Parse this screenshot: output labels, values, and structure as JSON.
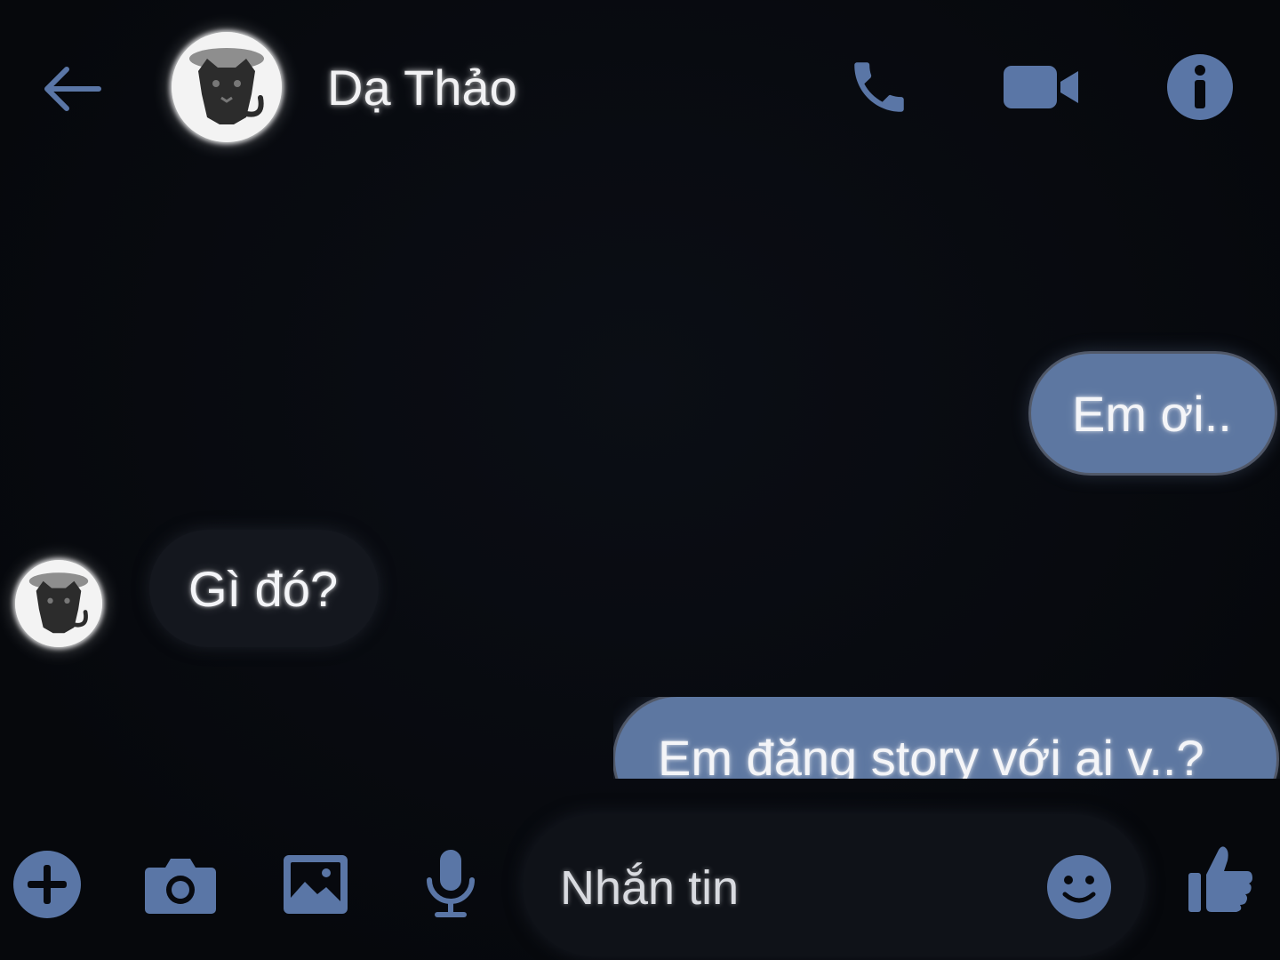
{
  "theme": {
    "accent": "#5a76a6",
    "bubble_outgoing": "#5d77a1",
    "bubble_incoming": "#14171e",
    "background": "#07090e"
  },
  "header": {
    "back_icon": "arrow-left-icon",
    "contact_name": "Dạ Thảo",
    "avatar": "cat-avatar",
    "actions": [
      {
        "icon": "phone-icon",
        "label": "call"
      },
      {
        "icon": "video-camera-icon",
        "label": "video"
      },
      {
        "icon": "info-icon",
        "label": "info"
      }
    ]
  },
  "messages": [
    {
      "direction": "outgoing",
      "text": "Em ơi.."
    },
    {
      "direction": "incoming",
      "text": "Gì đó?"
    },
    {
      "direction": "outgoing",
      "text": "Em đăng story với ai v..?"
    }
  ],
  "composer": {
    "tools": [
      "plus-icon",
      "camera-icon",
      "image-icon",
      "microphone-icon"
    ],
    "placeholder": "Nhắn tin",
    "emoji_icon": "smiley-icon",
    "send_icon": "thumbs-up-icon"
  }
}
